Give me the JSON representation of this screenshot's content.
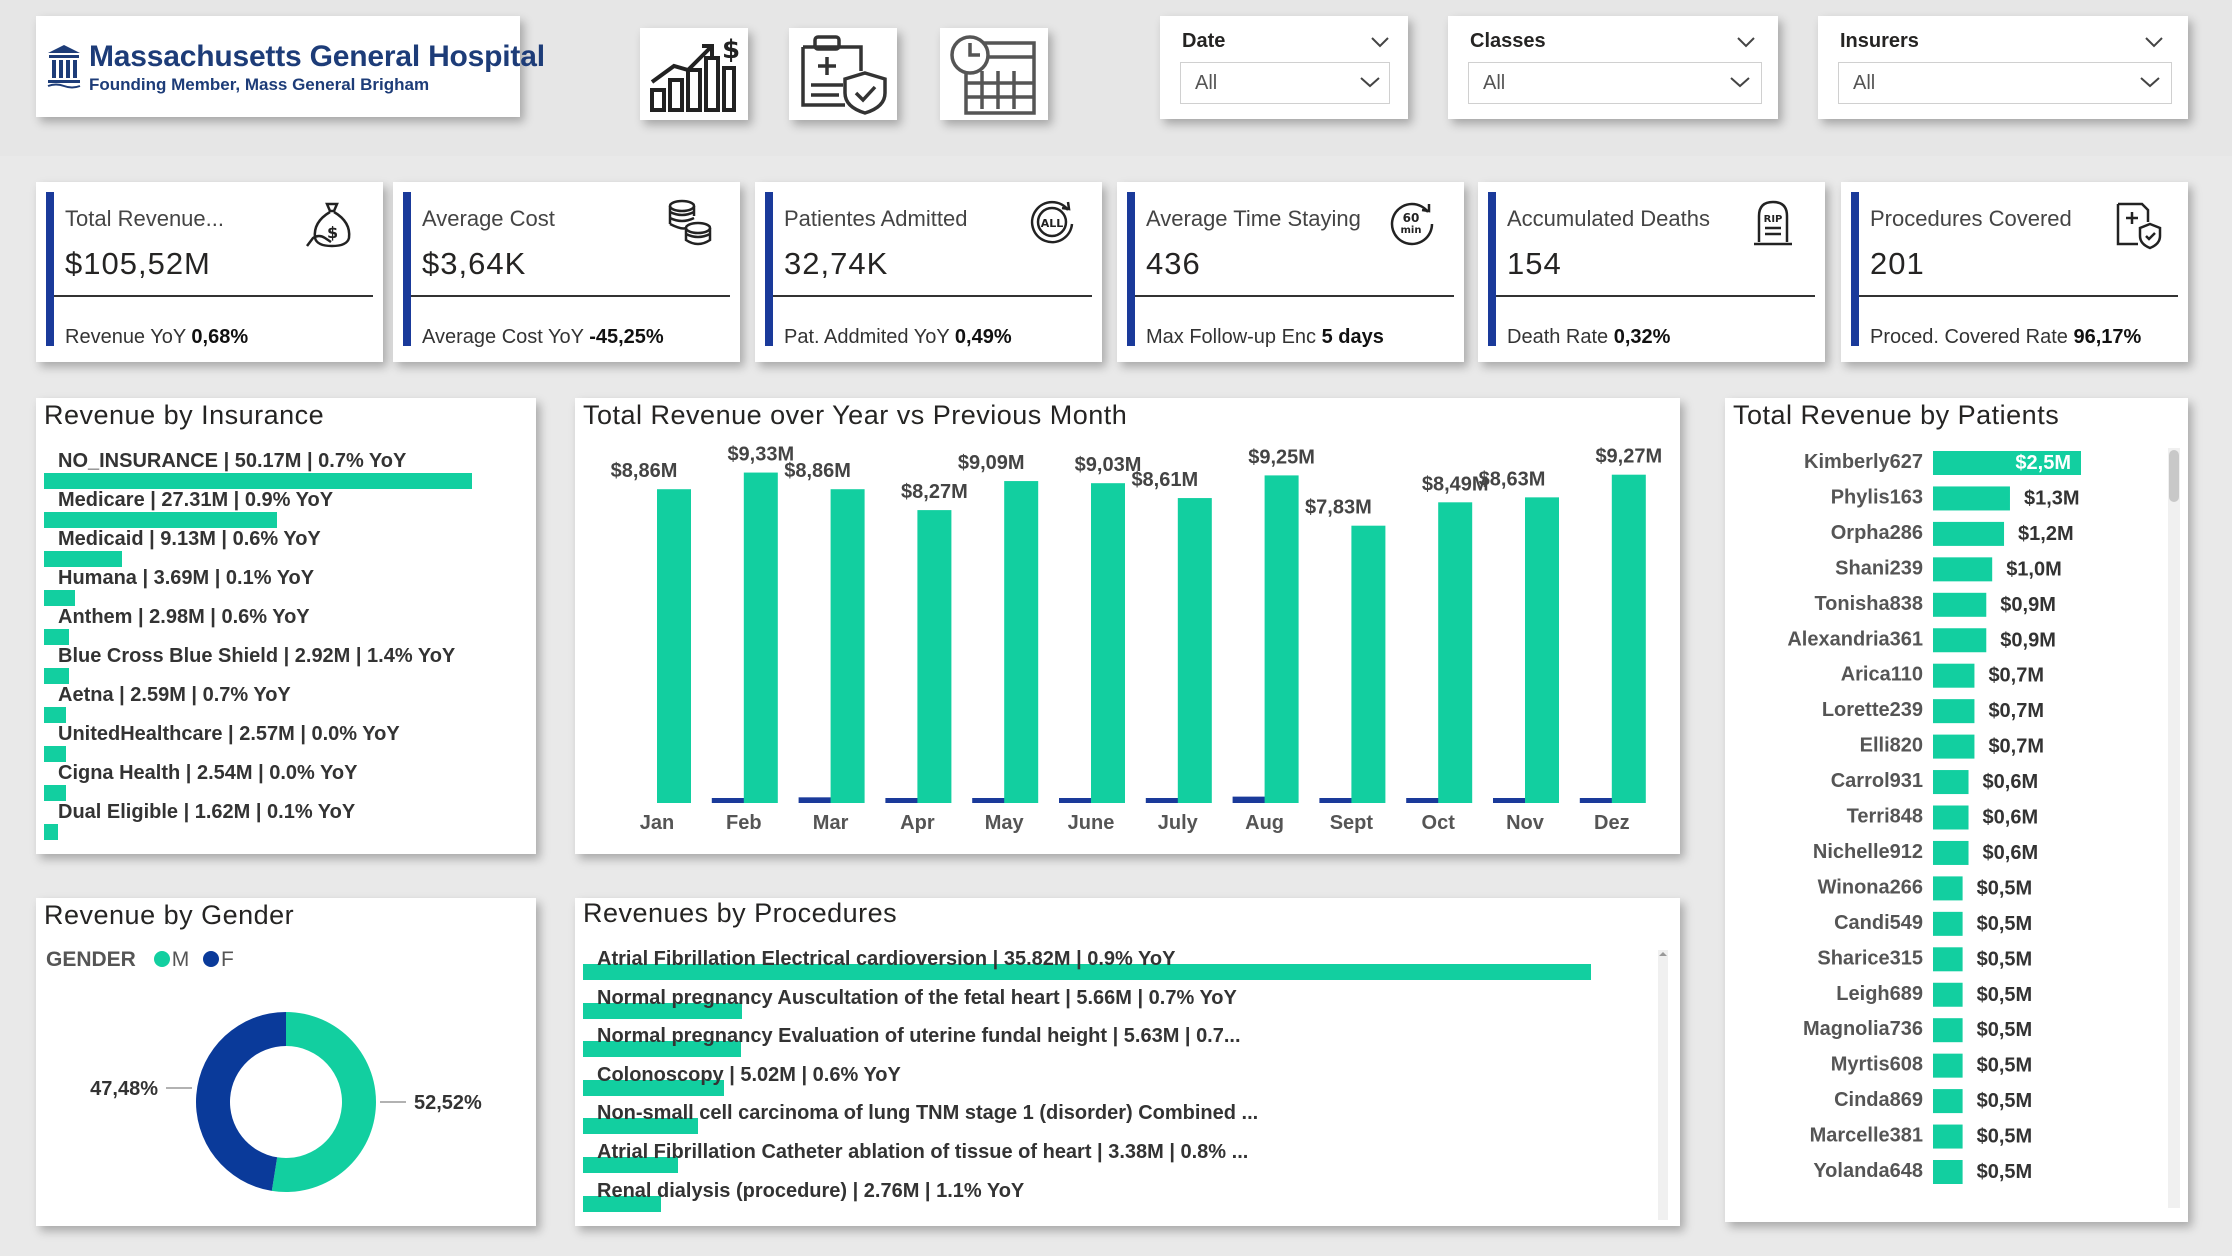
{
  "header": {
    "logo_title": "Massachusetts General Hospital",
    "logo_subtitle": "Founding Member, Mass General Brigham",
    "nav_icons": [
      "revenue-growth-icon",
      "insurance-document-icon",
      "schedule-calendar-icon"
    ]
  },
  "filters": [
    {
      "label": "Date",
      "value": "All"
    },
    {
      "label": "Classes",
      "value": "All"
    },
    {
      "label": "Insurers",
      "value": "All"
    }
  ],
  "kpis": [
    {
      "title": "Total Revenue...",
      "value": "$105,52M",
      "footer_label": "Revenue YoY",
      "footer_value": "0,68%",
      "icon": "money-bag-icon"
    },
    {
      "title": "Average Cost",
      "value": "$3,64K",
      "footer_label": "Average Cost YoY",
      "footer_value": "-45,25%",
      "icon": "coins-icon"
    },
    {
      "title": "Patientes Admitted",
      "value": "32,74K",
      "footer_label": "Pat. Addmited YoY",
      "footer_value": "0,49%",
      "icon": "all-cycle-icon",
      "icon_text": "ALL"
    },
    {
      "title": "Average Time Staying",
      "value": "436",
      "footer_label": "Max Follow-up Enc",
      "footer_value": "5 days",
      "icon": "timer-60-min-icon",
      "icon_text_1": "60",
      "icon_text_2": "min"
    },
    {
      "title": "Accumulated Deaths",
      "value": "154",
      "footer_label": "Death Rate",
      "footer_value": "0,32%",
      "icon": "tombstone-icon",
      "icon_text": "RIP"
    },
    {
      "title": "Procedures Covered",
      "value": "201",
      "footer_label": "Proced. Covered Rate",
      "footer_value": "96,17%",
      "icon": "medical-shield-document-icon"
    }
  ],
  "panels": {
    "insurance_title": "Revenue by Insurance",
    "revenue_title": "Total Revenue over Year vs Previous Month",
    "patients_title": "Total Revenue by Patients",
    "gender_title": "Revenue by Gender",
    "procedures_title": "Revenues by Procedures"
  },
  "colors": {
    "accent": "#12cfa0",
    "navy": "#1a3a9a"
  },
  "insurance": [
    {
      "label": "NO_INSURANCE | 50.17M | 0.7% YoY",
      "value": 50.17
    },
    {
      "label": "Medicare | 27.31M | 0.9% YoY",
      "value": 27.31
    },
    {
      "label": "Medicaid | 9.13M | 0.6% YoY",
      "value": 9.13
    },
    {
      "label": "Humana | 3.69M | 0.1% YoY",
      "value": 3.69
    },
    {
      "label": "Anthem | 2.98M | 0.6% YoY",
      "value": 2.98
    },
    {
      "label": "Blue Cross Blue Shield | 2.92M | 1.4% YoY",
      "value": 2.92
    },
    {
      "label": "Aetna | 2.59M | 0.7% YoY",
      "value": 2.59
    },
    {
      "label": "UnitedHealthcare | 2.57M | 0.0% YoY",
      "value": 2.57
    },
    {
      "label": "Cigna Health | 2.54M | 0.0% YoY",
      "value": 2.54
    },
    {
      "label": "Dual Eligible | 1.62M | 0.1% YoY",
      "value": 1.62
    }
  ],
  "gender": {
    "legend_title": "GENDER",
    "series": [
      {
        "name": "M",
        "value": 52.52,
        "label": "52,52%",
        "color": "#12cfa0"
      },
      {
        "name": "F",
        "value": 47.48,
        "label": "47,48%",
        "color": "#0a3a9a"
      }
    ]
  },
  "procedures": [
    {
      "label": "Atrial Fibrillation Electrical cardioversion | 35.82M | 0.9% YoY",
      "value": 35.82
    },
    {
      "label": "Normal pregnancy Auscultation of the fetal heart | 5.66M | 0.7% YoY",
      "value": 5.66
    },
    {
      "label": "Normal pregnancy Evaluation of uterine fundal height | 5.63M | 0.7...",
      "value": 5.63
    },
    {
      "label": "Colonoscopy | 5.02M | 0.6% YoY",
      "value": 5.02
    },
    {
      "label": "Non-small cell carcinoma of lung TNM stage 1 (disorder) Combined ...",
      "value": 4.1
    },
    {
      "label": "Atrial Fibrillation Catheter ablation of tissue of heart | 3.38M | 0.8% ...",
      "value": 3.38
    },
    {
      "label": "Renal dialysis (procedure) | 2.76M | 1.1% YoY",
      "value": 2.76
    }
  ],
  "chart_data": [
    {
      "type": "bar",
      "categories": [
        "Jan",
        "Feb",
        "Mar",
        "Apr",
        "May",
        "June",
        "July",
        "Aug",
        "Sept",
        "Oct",
        "Nov",
        "Dez"
      ],
      "series": [
        {
          "name": "",
          "values": [
            0.0,
            0.12,
            0.16,
            0.14,
            0.12,
            0.14,
            0.12,
            0.18,
            0.14,
            0.12,
            0.12,
            0.12
          ],
          "color": "#1a3a9a"
        },
        {
          "name": "",
          "values": [
            8.86,
            9.33,
            8.86,
            8.27,
            9.09,
            9.03,
            8.61,
            9.25,
            7.83,
            8.49,
            8.63,
            9.27
          ],
          "color": "#12cfa0"
        }
      ],
      "data_labels": [
        "$8,86M",
        "$9,33M",
        "$8,86M",
        "$8,27M",
        "$9,09M",
        "$9,03M",
        "$8,61M",
        "$9,25M",
        "$7,83M",
        "$8,49M",
        "$8,63M",
        "$9,27M"
      ],
      "ylim": [
        0,
        9.6
      ]
    },
    {
      "type": "bar",
      "orientation": "horizontal",
      "categories": [
        "Kimberly627",
        "Phylis163",
        "Orpha286",
        "Shani239",
        "Tonisha838",
        "Alexandria361",
        "Arica110",
        "Lorette239",
        "Elli820",
        "Carrol931",
        "Terri848",
        "Nichelle912",
        "Winona266",
        "Candi549",
        "Sharice315",
        "Leigh689",
        "Magnolia736",
        "Myrtis608",
        "Cinda869",
        "Marcelle381",
        "Yolanda648"
      ],
      "values": [
        2.5,
        1.3,
        1.2,
        1.0,
        0.9,
        0.9,
        0.7,
        0.7,
        0.7,
        0.6,
        0.6,
        0.6,
        0.5,
        0.5,
        0.5,
        0.5,
        0.5,
        0.5,
        0.5,
        0.5,
        0.5
      ],
      "data_labels": [
        "$2,5M",
        "$1,3M",
        "$1,2M",
        "$1,0M",
        "$0,9M",
        "$0,9M",
        "$0,7M",
        "$0,7M",
        "$0,7M",
        "$0,6M",
        "$0,6M",
        "$0,6M",
        "$0,5M",
        "$0,5M",
        "$0,5M",
        "$0,5M",
        "$0,5M",
        "$0,5M",
        "$0,5M",
        "$0,5M",
        "$0,5M"
      ]
    }
  ]
}
